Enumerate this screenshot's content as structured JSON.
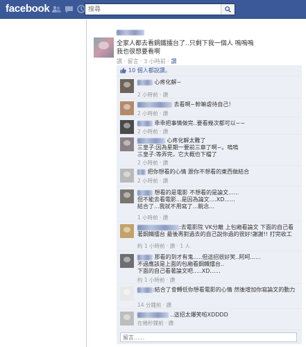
{
  "topbar": {
    "logo": "facebook",
    "search_placeholder": "搜尋",
    "icons": [
      "friends-icon",
      "messages-icon",
      "notifications-icon"
    ]
  },
  "post": {
    "text_line1": "全家人都去看鋼鐵擂台了..只剩下我一個人 嗚嗚嗚",
    "text_line2": "我也很想要看啊",
    "meta": "讚 · 留言 · 3 小時前 · ",
    "meta_extra": "讚"
  },
  "likes": {
    "label": "10 個人都說讚。"
  },
  "comments": [
    {
      "text": "心疼化解~",
      "meta": "2 小時前 · 讚"
    },
    {
      "text": "去看啊~幹嘛虐待自己！",
      "meta": "2 小時前 · 讚"
    },
    {
      "text": "乖乖把事情做完..要看幾次都可以~~",
      "meta": "2 小時前 · 讚"
    },
    {
      "text": "心疼化解太難了\n三皇子:因為星期一要前三章了啊~。嗚嗚\n三皇子:等弄完，它大概也下檔了",
      "meta": "2 小時前 · 讚"
    },
    {
      "text": "把你想看的心情 跟你不想看的東西做結合",
      "meta": "2 小時前 · 讚"
    },
    {
      "text": "想看的是電影 不想看的是論文......\n但不能去看電影...是因為論文....XD......\n結合了...我就不用寫了...眺念...",
      "meta": "1 小時前 · 讚"
    },
    {
      "text": ":去電影院 VK分離 上包廂看論文 下面的自己看著鋼鐵擂台 最後再對過去的自己說你過的很好!謝謝!! 打完收工",
      "meta": "約 1 小時前 · 讚 · 1 人"
    },
    {
      "text": "那看的到才有鬼.....但這招很好笑..阿呵......\n不過應該是上面的包廂看鋼鐵擂台..\n下面的自己看著論文吧.....XD......",
      "meta": "約 1 小時前 · 讚"
    },
    {
      "text": ":結合了會轉低你想看電影的心情 然後增加你寫論文的動力",
      "meta": "14 分鐘前 · 讚"
    },
    {
      "text": "..這招太爆笑啦XDDDD",
      "meta": "在幾秒鐘前 · 讚"
    }
  ],
  "composer": {
    "placeholder": "留言......"
  },
  "colors": {
    "brand": "#3b5998",
    "panel": "#eceff5",
    "link": "#3b5998"
  }
}
